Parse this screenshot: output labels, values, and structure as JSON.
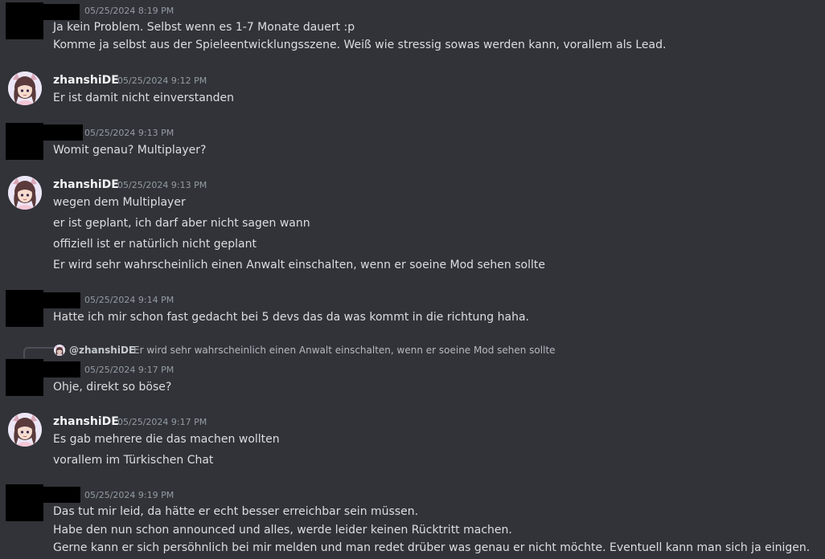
{
  "colors": {
    "background": "#313338",
    "text": "#dbdee1",
    "timestamp": "#949ba4",
    "author": "#f2f3f5",
    "redaction": "#000000"
  },
  "messages": [
    {
      "author": "",
      "redacted": true,
      "timestamp": "05/25/2024 8:19 PM",
      "lines": [
        "Ja kein Problem. Selbst wenn es 1-7 Monate dauert :p",
        "Komme ja selbst aus der Spieleentwicklungsszene. Weiß wie stressig sowas werden kann, vorallem als Lead."
      ]
    },
    {
      "author": "zhanshiDE",
      "avatar_icon": "anime-girl-avatar-icon",
      "timestamp": "05/25/2024 9:12 PM",
      "lines": [
        "Er ist damit nicht einverstanden"
      ]
    },
    {
      "author": "",
      "redacted": true,
      "timestamp": "05/25/2024 9:13 PM",
      "lines": [
        "Womit genau? Multiplayer?"
      ]
    },
    {
      "author": "zhanshiDE",
      "avatar_icon": "anime-girl-avatar-icon",
      "timestamp": "05/25/2024 9:13 PM",
      "lines": [
        "wegen dem Multiplayer",
        "er ist geplant, ich darf aber nicht sagen wann",
        "offiziell ist er natürlich nicht geplant",
        "Er wird sehr wahrscheinlich einen Anwalt einschalten, wenn er soeine Mod sehen sollte"
      ]
    },
    {
      "author": "",
      "redacted": true,
      "timestamp": "05/25/2024 9:14 PM",
      "lines": [
        "Hatte ich mir schon fast gedacht bei 5 devs das da was kommt in die richtung haha."
      ]
    },
    {
      "author": "",
      "redacted": true,
      "timestamp": "05/25/2024 9:17 PM",
      "reply": {
        "author": "@zhanshiDE",
        "text": "Er wird sehr wahrscheinlich einen Anwalt einschalten, wenn er soeine Mod sehen sollte"
      },
      "lines": [
        "Ohje, direkt so böse?"
      ]
    },
    {
      "author": "zhanshiDE",
      "avatar_icon": "anime-girl-avatar-icon",
      "timestamp": "05/25/2024 9:17 PM",
      "lines": [
        "Es gab mehrere die das machen wollten",
        "vorallem im Türkischen Chat"
      ]
    },
    {
      "author": "",
      "redacted": true,
      "timestamp": "05/25/2024 9:19 PM",
      "lines": [
        "Das tut mir leid, da hätte er echt besser erreichbar sein müssen.",
        "Habe den nun schon announced und alles, werde leider keinen Rücktritt machen.",
        "Gerne kann er sich persöhnlich bei mir melden und man redet drüber was genau er nicht möchte. Eventuell kann man sich ja einigen."
      ]
    }
  ]
}
